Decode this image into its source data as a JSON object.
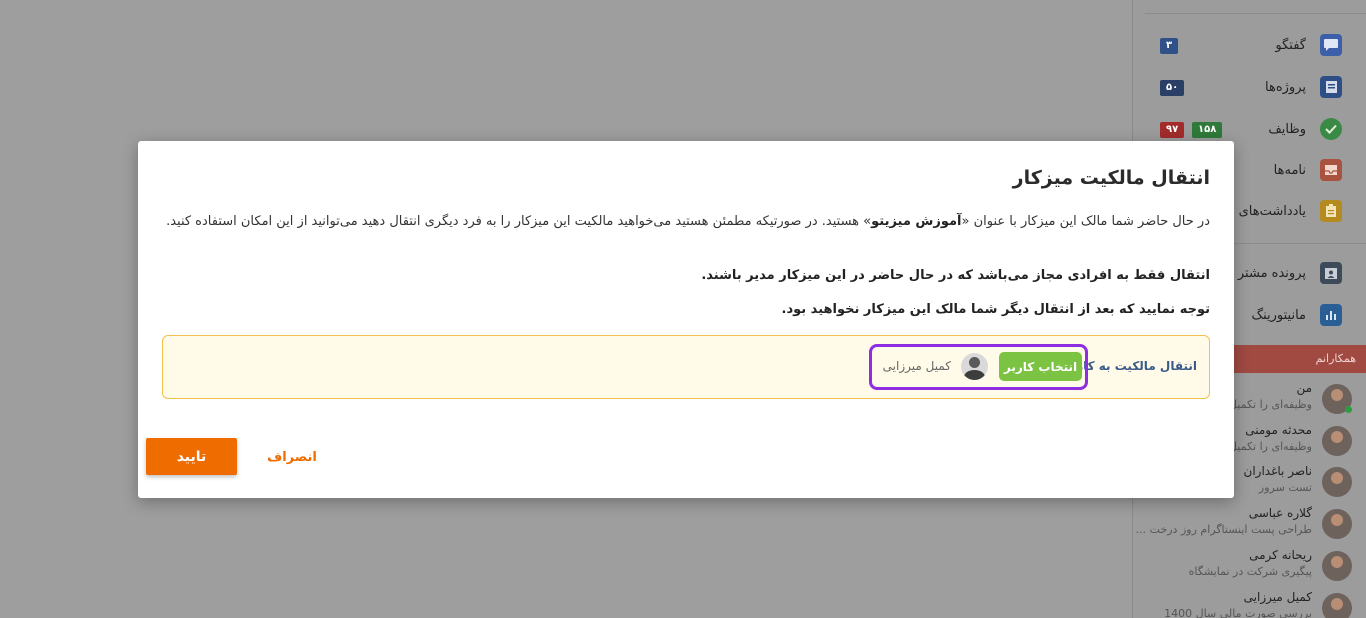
{
  "sidebar": {
    "nav": [
      {
        "label": "گفتگو",
        "icon": "chat-icon",
        "badges": [
          "۳"
        ]
      },
      {
        "label": "پروژه‌ها",
        "icon": "projects-icon",
        "badges": [
          "۵۰"
        ]
      },
      {
        "label": "وظایف",
        "icon": "tasks-icon",
        "badges": [
          "۱۵۸",
          "۹۷"
        ]
      },
      {
        "label": "نامه‌ها",
        "icon": "letters-icon",
        "badges": []
      },
      {
        "label": "یادداشت‌های",
        "icon": "notes-icon",
        "badges": []
      },
      {
        "label": "پرونده مشتر",
        "icon": "customer-file-icon",
        "badges": []
      },
      {
        "label": "مانیتورینگ",
        "icon": "monitoring-icon",
        "badges": []
      }
    ],
    "team_header": "همکارانم",
    "members": [
      {
        "name": "من",
        "sub": "وظیفه‌ای را تکمیل"
      },
      {
        "name": "محدثه مومنی",
        "sub": "وظیفه‌ای را تکمیل"
      },
      {
        "name": "ناصر باغداران",
        "sub": "تست سرور"
      },
      {
        "name": "گلاره عباسی",
        "sub": "طراحی پست اینستاگرام روز درخت ..."
      },
      {
        "name": "ریحانه کرمی",
        "sub": "پیگیری شرکت در نمایشگاه"
      },
      {
        "name": "کمیل میرزایی",
        "sub": "بررسی صورت مالی سال 1400"
      }
    ]
  },
  "modal": {
    "title": "انتقال مالکیت میزکار",
    "desc_part1": "در حال حاضر شما مالک این میزکار با عنوان «",
    "desc_workspace": "آموزش میزیتو",
    "desc_part2": "» هستید. در صورتیکه مطمئن هستید می‌خواهید مالکیت این میزکار را به فرد دیگری انتقال دهید می‌توانید از این امکان استفاده کنید.",
    "note1": "انتقال فقط به افرادی مجاز می‌باشد که در حال حاضر در این میزکار مدیر باشند.",
    "note2": "توجه نمایید که بعد از انتقال دیگر شما مالک این میزکار نخواهید بود.",
    "transfer_label": "انتقال مالکیت به کاربر",
    "select_user_button": "انتخاب کاربر",
    "selected_user_name": "کمیل میرزایی",
    "confirm_button": "تایید",
    "cancel_button": "انصراف"
  },
  "colors": {
    "accent": "#ef6c00",
    "select_button": "#7cc243",
    "highlight_border": "#8e2de2",
    "transfer_box_bg": "#fffbe8",
    "transfer_box_border": "#f2c14c"
  }
}
